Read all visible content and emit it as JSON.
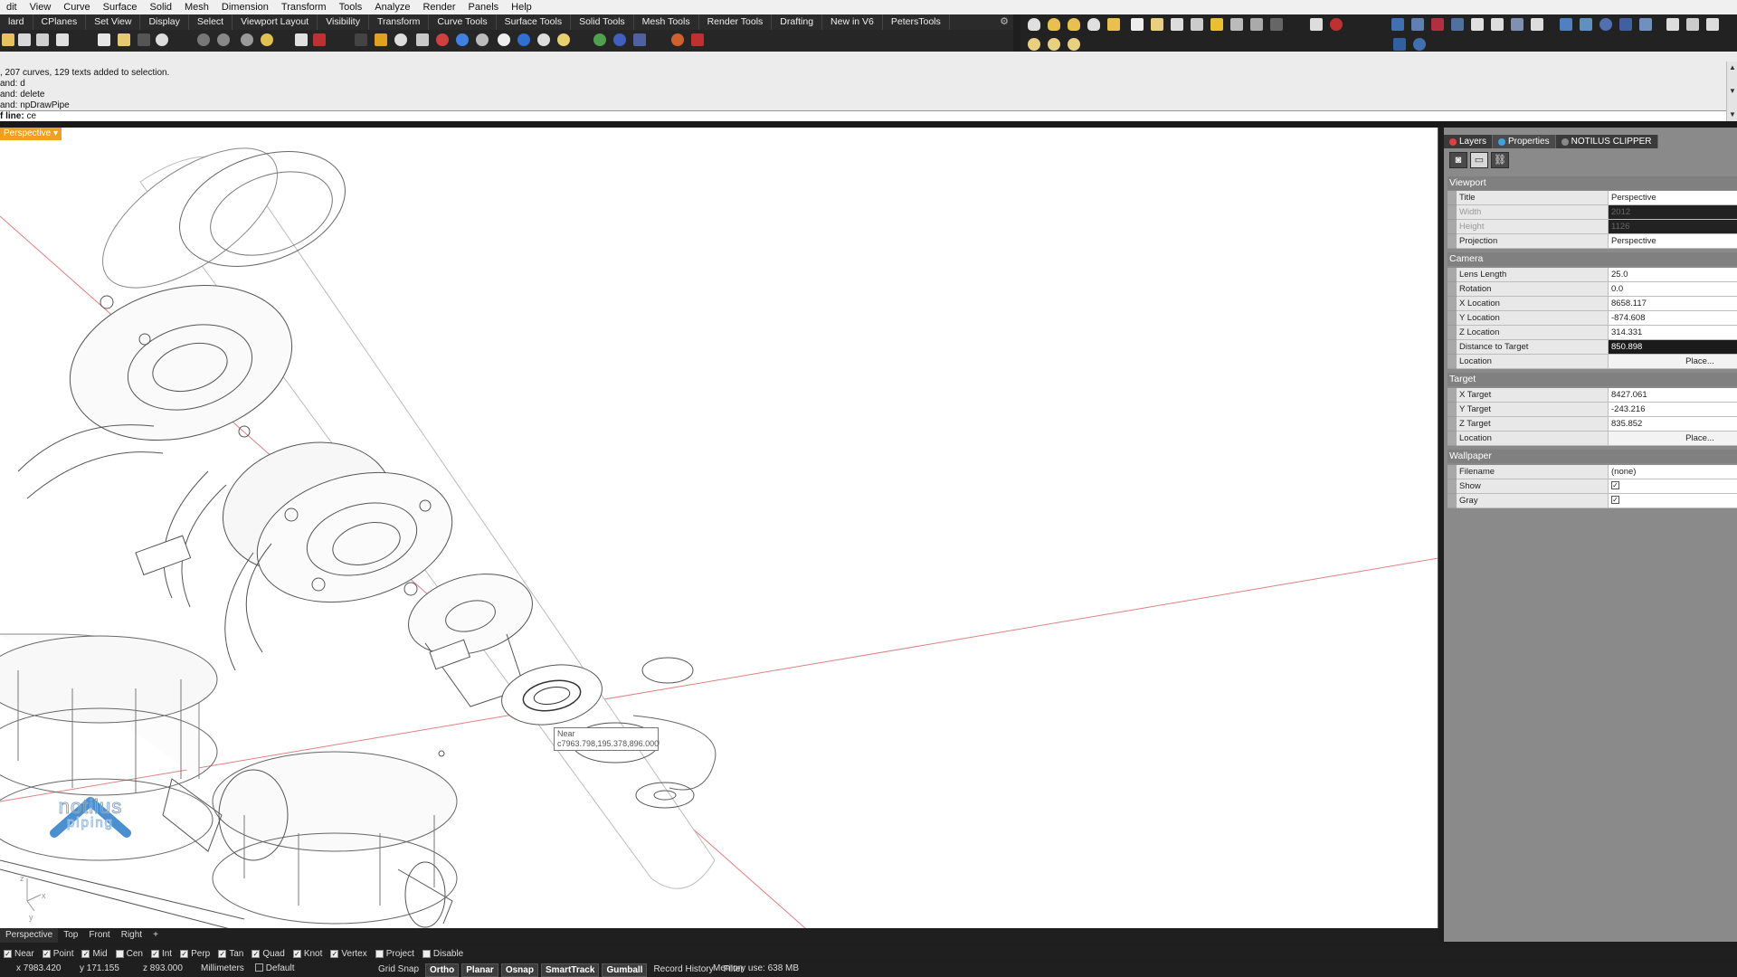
{
  "menu": [
    "dit",
    "View",
    "Curve",
    "Surface",
    "Solid",
    "Mesh",
    "Dimension",
    "Transform",
    "Tools",
    "Analyze",
    "Render",
    "Panels",
    "Help"
  ],
  "toolbar_tabs": [
    "lard",
    "CPlanes",
    "Set View",
    "Display",
    "Select",
    "Viewport Layout",
    "Visibility",
    "Transform",
    "Curve Tools",
    "Surface Tools",
    "Solid Tools",
    "Mesh Tools",
    "Render Tools",
    "Drafting",
    "New in V6",
    "PetersTools"
  ],
  "command_history": [
    ", 207 curves, 129 texts added to selection.",
    "and: d",
    "and: delete",
    "and: npDrawPipe"
  ],
  "command_prompt": {
    "label": "f line:",
    "value": "ce"
  },
  "viewport": {
    "title": "Perspective"
  },
  "osnap_tooltip": {
    "line1": "Near",
    "line2": "c7963.798,195.378,896.000"
  },
  "logo": {
    "name": "notilus",
    "sub": "piping"
  },
  "axis_labels": {
    "x": "x",
    "y": "y",
    "z": "z"
  },
  "panel": {
    "tabs": [
      {
        "label": "Layers",
        "color": "#e04040"
      },
      {
        "label": "Properties",
        "color": "#40a0e0"
      },
      {
        "label": "NOTILUS CLIPPER",
        "color": "#888888"
      }
    ],
    "sections": {
      "viewport": {
        "title": "Viewport",
        "rows": [
          {
            "label": "Title",
            "value": "Perspective"
          },
          {
            "label": "Width",
            "value": "2012"
          },
          {
            "label": "Height",
            "value": "1126"
          },
          {
            "label": "Projection",
            "value": "Perspective"
          }
        ]
      },
      "camera": {
        "title": "Camera",
        "rows": [
          {
            "label": "Lens Length",
            "value": "25.0"
          },
          {
            "label": "Rotation",
            "value": "0.0"
          },
          {
            "label": "X Location",
            "value": "8658.117"
          },
          {
            "label": "Y Location",
            "value": "-874.608"
          },
          {
            "label": "Z Location",
            "value": "314.331"
          },
          {
            "label": "Distance to Target",
            "value": "850.898"
          },
          {
            "label": "Location",
            "value": "Place..."
          }
        ]
      },
      "target": {
        "title": "Target",
        "rows": [
          {
            "label": "X Target",
            "value": "8427.061"
          },
          {
            "label": "Y Target",
            "value": "-243.216"
          },
          {
            "label": "Z Target",
            "value": "835.852"
          },
          {
            "label": "Location",
            "value": "Place..."
          }
        ]
      },
      "wallpaper": {
        "title": "Wallpaper",
        "rows": [
          {
            "label": "Filename",
            "value": "(none)"
          },
          {
            "label": "Show",
            "value": "✓"
          },
          {
            "label": "Gray",
            "value": "✓"
          }
        ]
      }
    }
  },
  "viewport_tabs": [
    "Perspective",
    "Top",
    "Front",
    "Right",
    "+"
  ],
  "osnaps": [
    {
      "label": "Near",
      "checked": true
    },
    {
      "label": "Point",
      "checked": true
    },
    {
      "label": "Mid",
      "checked": true
    },
    {
      "label": "Cen",
      "checked": false
    },
    {
      "label": "Int",
      "checked": true
    },
    {
      "label": "Perp",
      "checked": true
    },
    {
      "label": "Tan",
      "checked": true
    },
    {
      "label": "Quad",
      "checked": true
    },
    {
      "label": "Knot",
      "checked": true
    },
    {
      "label": "Vertex",
      "checked": true
    },
    {
      "label": "Project",
      "checked": false
    },
    {
      "label": "Disable",
      "checked": false
    }
  ],
  "status": {
    "x": "x 7983.420",
    "y": "y 171.155",
    "z": "z 893.000",
    "units": "Millimeters",
    "layer": "Default",
    "toggles": [
      "Grid Snap",
      "Ortho",
      "Planar",
      "Osnap",
      "SmartTrack",
      "Gumball",
      "Record History",
      "Filter"
    ],
    "toggles_on": [
      false,
      true,
      true,
      true,
      true,
      true,
      false,
      false
    ],
    "memory": "Memory use: 638 MB"
  },
  "colors": {
    "viewport_title": "#f0a020",
    "axis_red": "#e07070",
    "panel_bg": "#8a8a8a"
  }
}
